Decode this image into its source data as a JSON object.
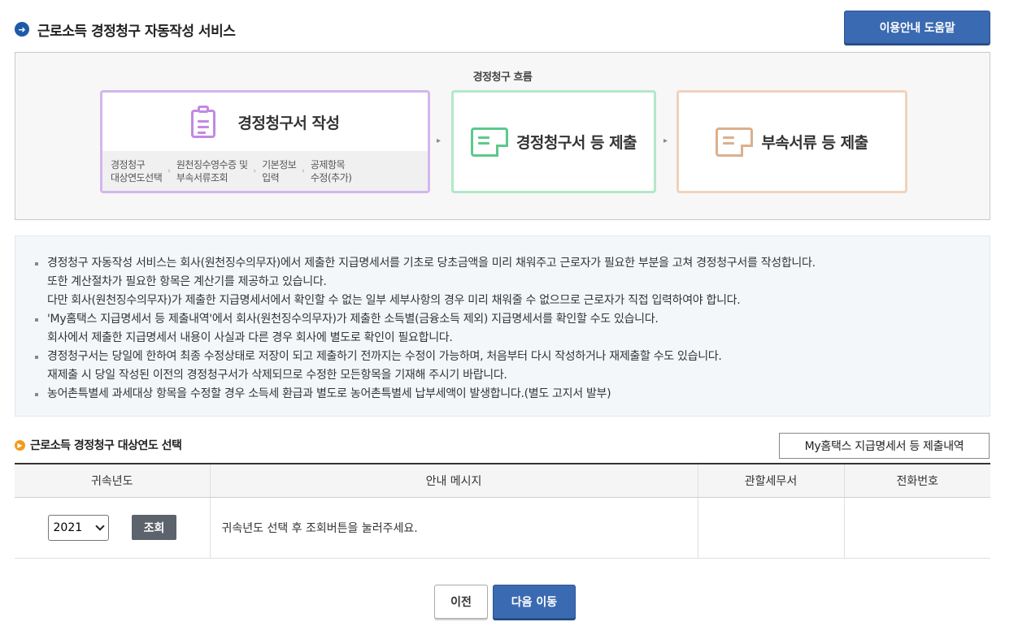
{
  "header": {
    "title": "근로소득 경정청구 자동작성 서비스",
    "help_button": "이용안내 도움말"
  },
  "flow": {
    "title": "경정청구 흐름",
    "step1": {
      "label": "경정청구서 작성",
      "substeps": [
        {
          "line1": "경정청구",
          "line2": "대상연도선택"
        },
        {
          "line1": "원천징수영수증 및",
          "line2": "부속서류조회"
        },
        {
          "line1": "기본정보",
          "line2": "입력"
        },
        {
          "line1": "공제항목",
          "line2": "수정(추가)"
        }
      ]
    },
    "step2": {
      "label": "경정청구서 등 제출"
    },
    "step3": {
      "label": "부속서류 등 제출"
    }
  },
  "notices": [
    {
      "lines": [
        "경정청구 자동작성 서비스는 회사(원천징수의무자)에서 제출한 지급명세서를 기초로 당초금액을 미리 채워주고 근로자가 필요한 부분을 고쳐 경정청구서를 작성합니다.",
        "또한 계산절차가 필요한 항목은 계산기를 제공하고 있습니다.",
        "다만 회사(원천징수의무자)가 제출한 지급명세서에서 확인할 수 없는 일부 세부사항의 경우 미리 채워줄 수 없으므로 근로자가 직접 입력하여야 합니다."
      ]
    },
    {
      "lines": [
        "'My홈택스 지급명세서 등 제출내역'에서 회사(원천징수의무자)가 제출한 소득별(금융소득 제외) 지급명세서를 확인할 수도 있습니다.",
        "회사에서 제출한 지급명세서 내용이 사실과 다른 경우 회사에 별도로 확인이 필요합니다."
      ]
    },
    {
      "lines": [
        "경정청구서는 당일에 한하여 최종 수정상태로 저장이 되고 제출하기 전까지는 수정이 가능하며, 처음부터 다시 작성하거나 재제출할 수도 있습니다.",
        "재제출 시 당일 작성된 이전의 경정청구서가 삭제되므로 수정한 모든항목을 기재해 주시기 바랍니다."
      ]
    },
    {
      "lines": [
        "농어촌특별세 과세대상 항목을 수정할 경우 소득세 환급과 별도로 농어촌특별세 납부세액이 발생합니다.(별도 고지서 발부)"
      ]
    }
  ],
  "section": {
    "title": "근로소득 경정청구 대상연도 선택",
    "myhometax_button": "My홈택스 지급명세서 등 제출내역"
  },
  "table": {
    "headers": [
      "귀속년도",
      "안내 메시지",
      "관할세무서",
      "전화번호"
    ],
    "row": {
      "year": "2021",
      "query_button": "조회",
      "message": "귀속년도 선택 후 조회버튼을 눌러주세요.",
      "tax_office": "",
      "phone": ""
    }
  },
  "footer": {
    "prev_button": "이전",
    "next_button": "다음 이동"
  },
  "colors": {
    "primary_blue": "#3a6ab1",
    "step1_border": "#d3b7ec",
    "step2_border": "#b2e8c8",
    "step3_border": "#f0d2bc",
    "section_icon": "#f39a1c"
  }
}
